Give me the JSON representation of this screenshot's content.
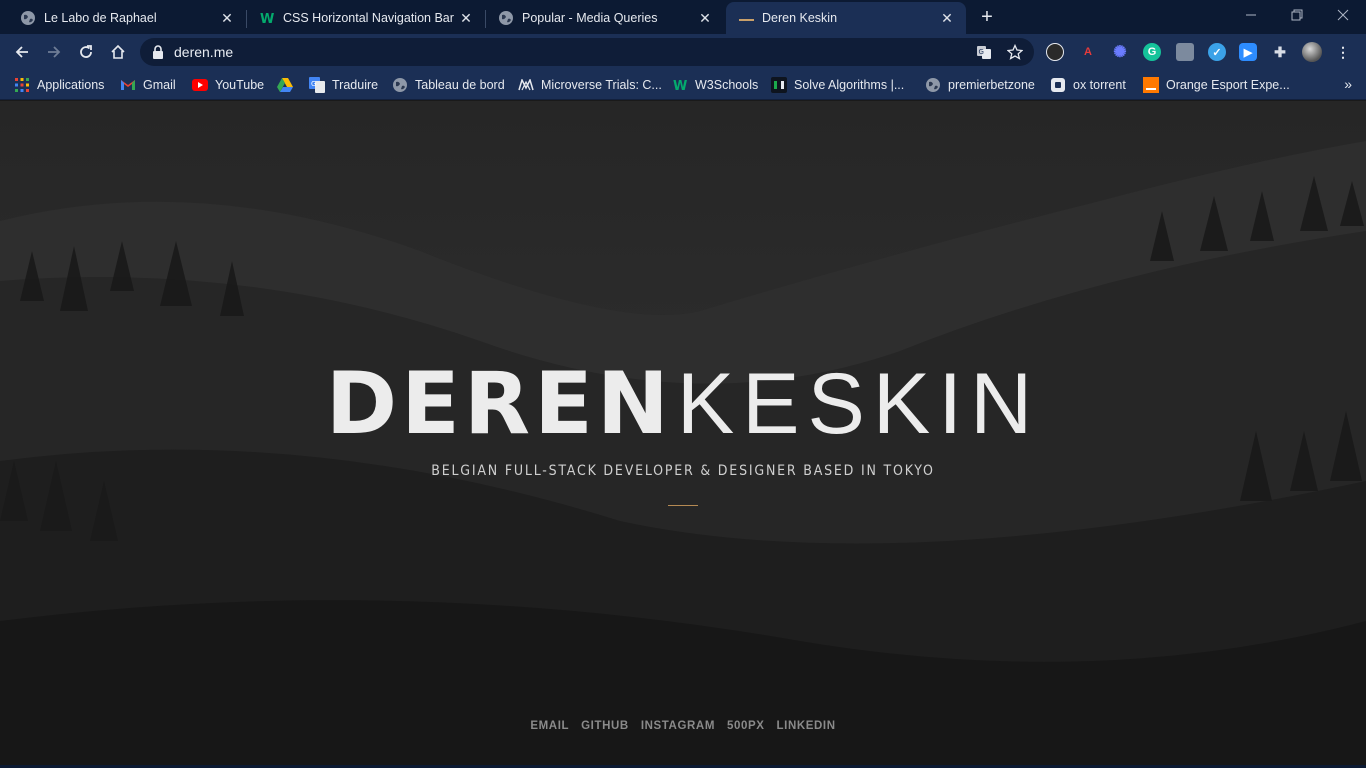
{
  "browser": {
    "tabs": [
      {
        "title": "Le Labo de Raphael",
        "icon": "globe-icon"
      },
      {
        "title": "CSS Horizontal Navigation Bar",
        "icon": "w3schools-icon"
      },
      {
        "title": "Popular - Media Queries",
        "icon": "globe-icon"
      },
      {
        "title": "Deren Keskin",
        "icon": "site-icon",
        "active": true
      }
    ],
    "address": "deren.me",
    "bookmarks": [
      {
        "label": "Applications",
        "icon": "apps-grid-icon"
      },
      {
        "label": "Gmail",
        "icon": "gmail-icon"
      },
      {
        "label": "YouTube",
        "icon": "youtube-icon"
      },
      {
        "label": "",
        "icon": "google-drive-icon"
      },
      {
        "label": "Traduire",
        "icon": "google-translate-icon"
      },
      {
        "label": "Tableau de bord",
        "icon": "globe-icon"
      },
      {
        "label": "Microverse Trials: C...",
        "icon": "microverse-icon"
      },
      {
        "label": "W3Schools",
        "icon": "w3schools-icon"
      },
      {
        "label": "Solve Algorithms |...",
        "icon": "hackerrank-icon"
      },
      {
        "label": "premierbetzone",
        "icon": "globe-icon"
      },
      {
        "label": "ox torrent",
        "icon": "oxtorrent-icon"
      },
      {
        "label": "Orange Esport Expe...",
        "icon": "orange-icon"
      }
    ]
  },
  "hero": {
    "first_name": "DEREN",
    "last_name": "KESKIN",
    "tagline": "BELGIAN FULL-STACK DEVELOPER & DESIGNER BASED IN TOKYO"
  },
  "social_links": [
    "EMAIL",
    "GITHUB",
    "INSTAGRAM",
    "500PX",
    "LINKEDIN"
  ],
  "colors": {
    "chrome_dark": "#0c1a33",
    "chrome": "#1b2f55",
    "accent_line": "#b58a53"
  }
}
